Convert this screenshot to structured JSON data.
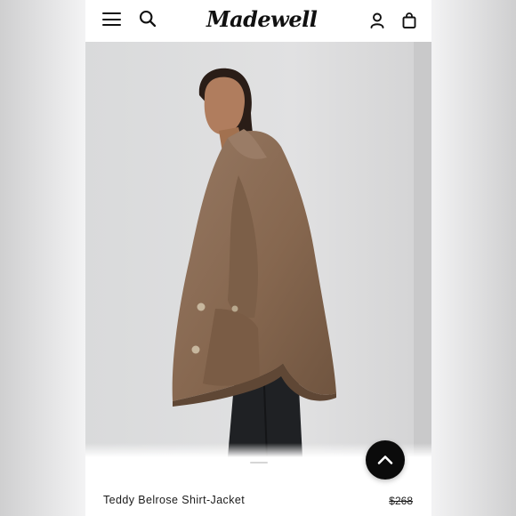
{
  "header": {
    "brand": "Madewell",
    "icons": {
      "menu": "hamburger-menu-icon",
      "search": "search-icon",
      "account": "account-icon",
      "bag": "shopping-bag-icon"
    }
  },
  "product": {
    "name": "Teddy Belrose Shirt-Jacket",
    "price": "$268",
    "price_struck": true
  },
  "scroll_top": {
    "icon": "chevron-up-icon"
  },
  "colors": {
    "page_background": "#f3f3f4",
    "header_background": "#ffffff",
    "photo_background": "#dddedf",
    "jacket": "#8a6b55",
    "text": "#1a1a1a",
    "scroll_button": "#0b0b0b"
  }
}
